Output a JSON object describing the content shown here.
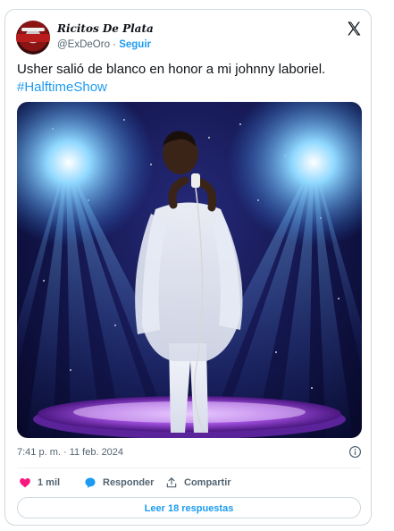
{
  "author": {
    "display_name": "Ricitos De Plata",
    "handle": "@ExDeOro",
    "separator": "·",
    "follow_label": "Seguir"
  },
  "tweet": {
    "text": "Usher salió de blanco en honor a mi johnny laboriel.",
    "hashtag": "#HalftimeShow",
    "timestamp": "7:41 p. m. · 11 feb. 2024"
  },
  "actions": {
    "like_count": "1 mil",
    "reply_label": "Responder",
    "share_label": "Compartir",
    "read_replies_label": "Leer 18 respuestas"
  },
  "colors": {
    "accent": "#1d9bf0",
    "like": "#f91880",
    "text_secondary": "#536471"
  },
  "icons": [
    "x-logo-icon",
    "info-icon",
    "heart-icon",
    "reply-bubble-icon",
    "share-icon"
  ]
}
